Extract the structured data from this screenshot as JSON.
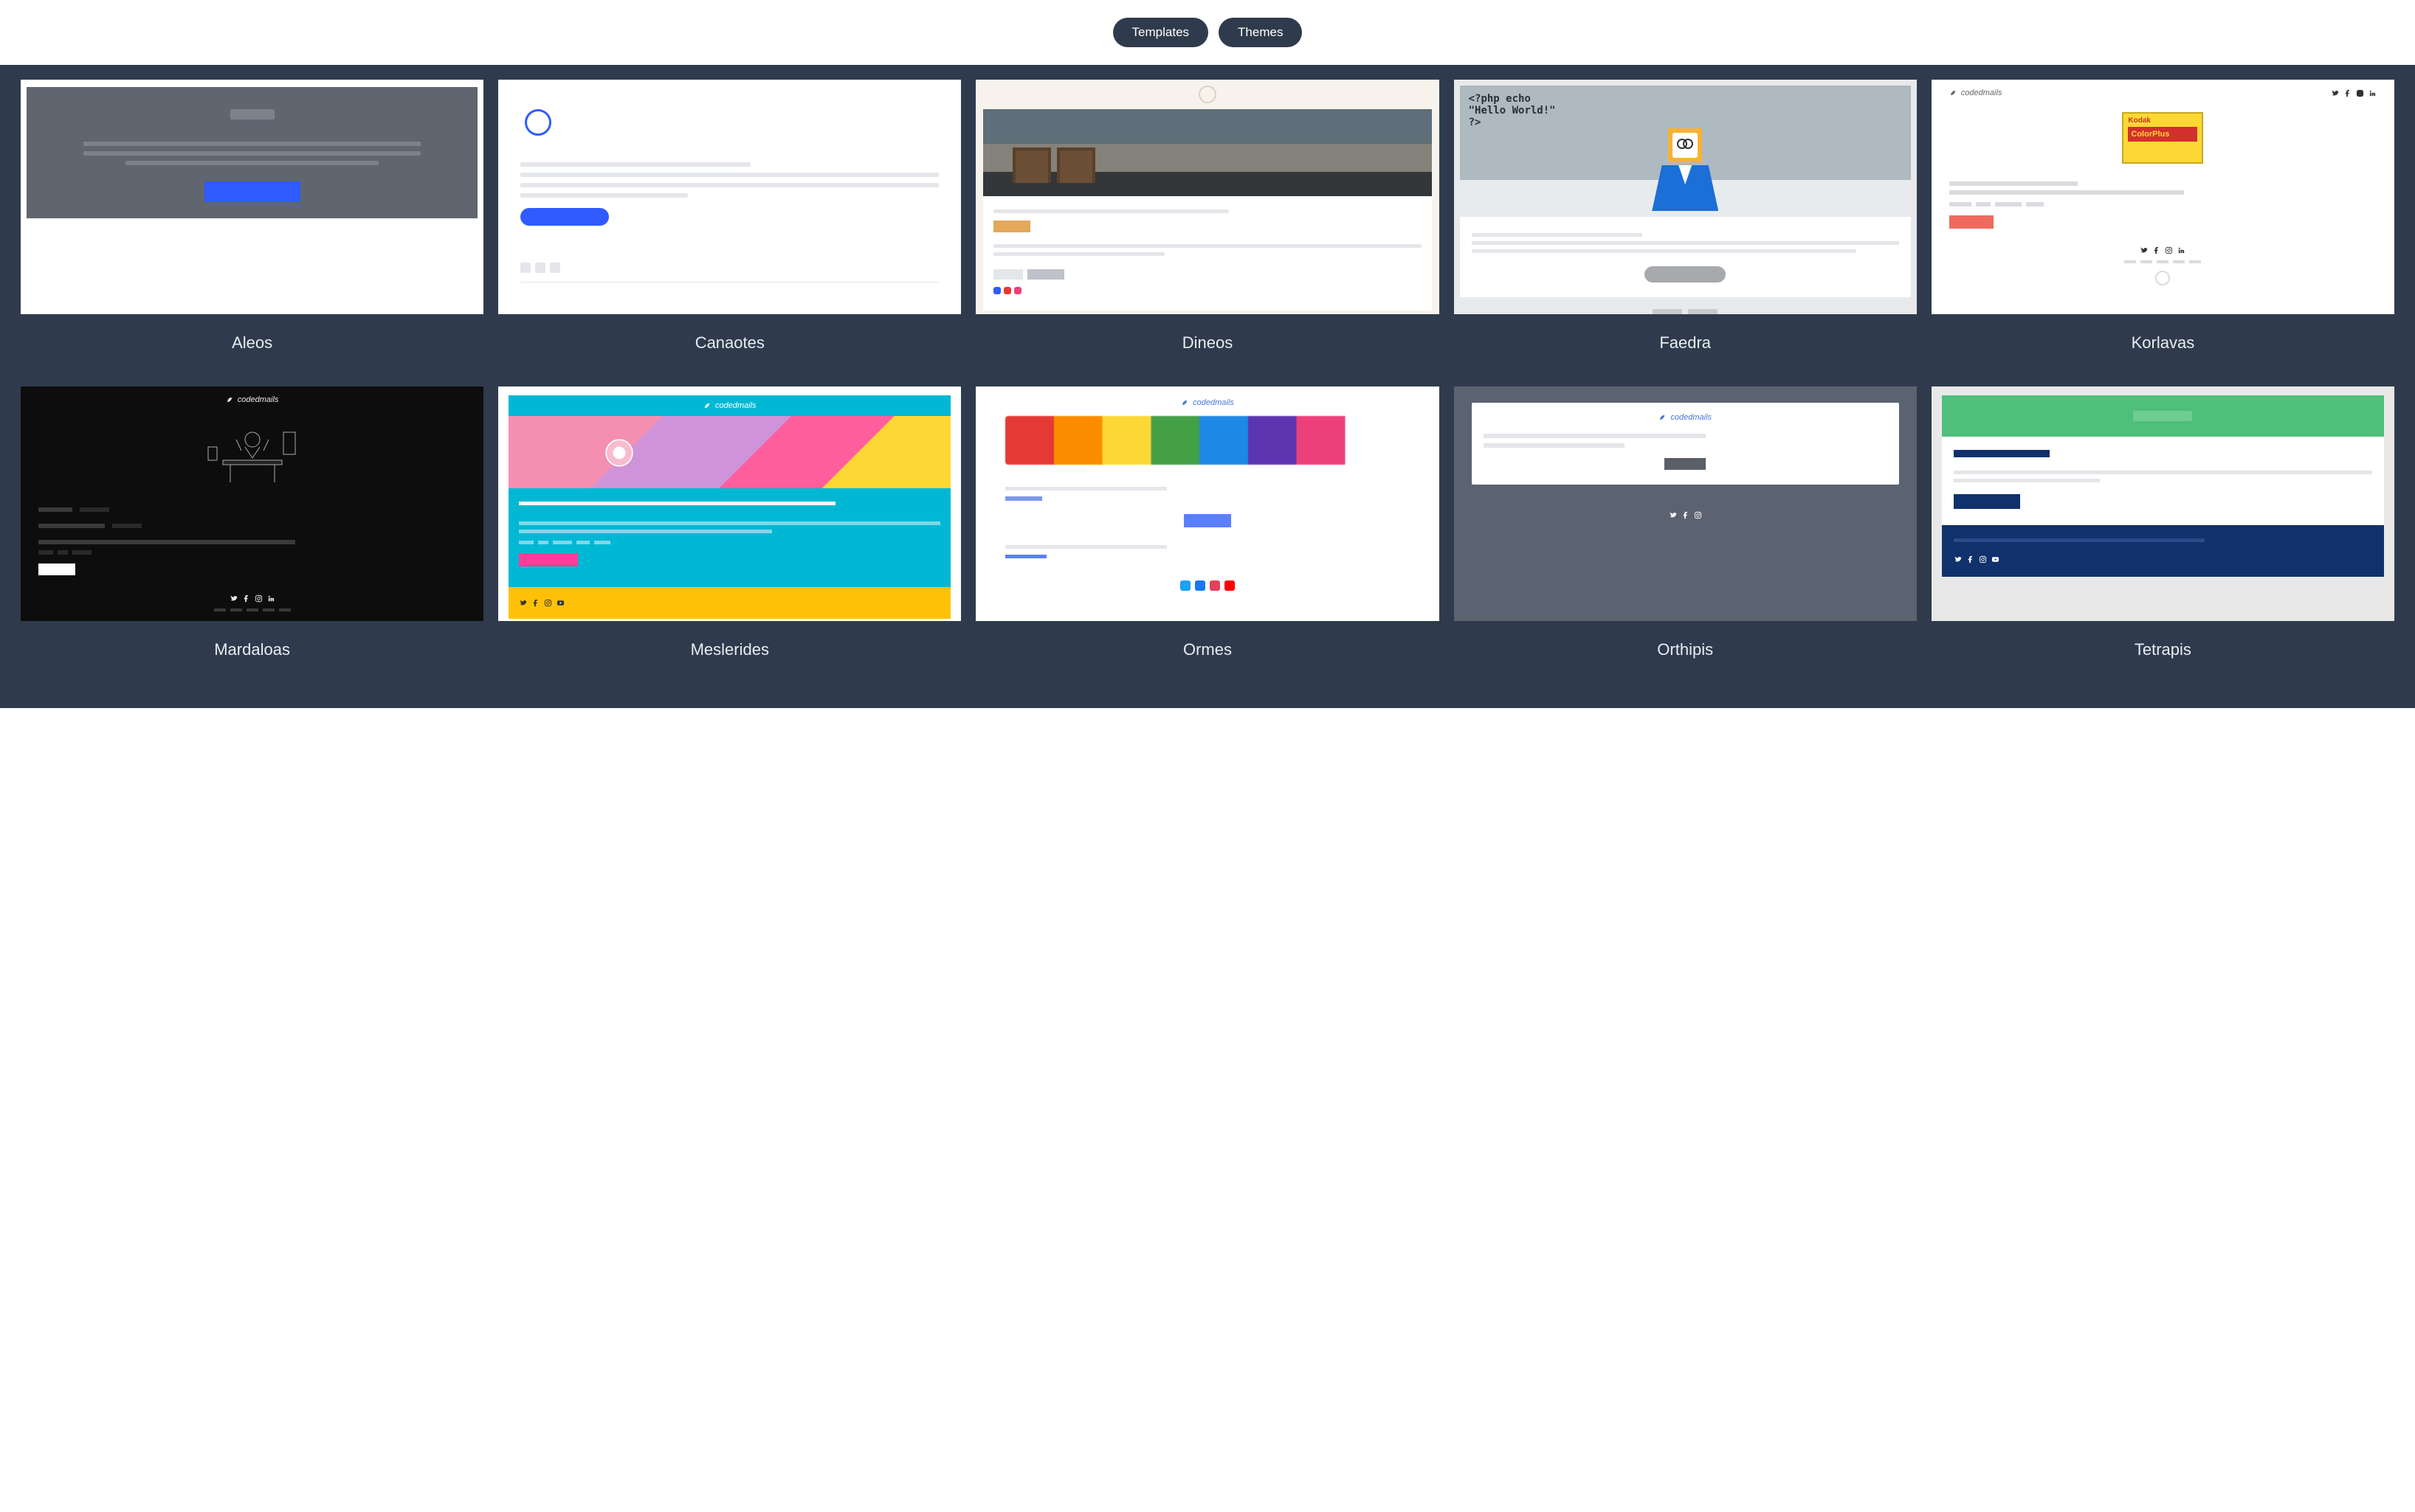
{
  "tabs": {
    "templates": "Templates",
    "themes": "Themes"
  },
  "themes": [
    {
      "name": "Aleos"
    },
    {
      "name": "Canaotes"
    },
    {
      "name": "Dineos"
    },
    {
      "name": "Faedra"
    },
    {
      "name": "Korlavas"
    },
    {
      "name": "Mardaloas"
    },
    {
      "name": "Meslerides"
    },
    {
      "name": "Ormes"
    },
    {
      "name": "Orthipis"
    },
    {
      "name": "Tetrapis"
    }
  ],
  "preview_text": {
    "faedra_code": "<?php echo\n\"Hello World!\"\n?>",
    "brand": "codedmails",
    "kodak": "Kodak",
    "colorplus": "ColorPlus"
  },
  "colors": {
    "page_bg": "#2F3B4C",
    "accent_blue": "#2F5BFF",
    "accent_orange": "#E3A859",
    "accent_pink": "#FF3D9A",
    "accent_cyan": "#00B8D4",
    "accent_green": "#4FBF7C",
    "accent_navy": "#10316B",
    "accent_coral": "#EF6A5E",
    "accent_yellow": "#FFC107"
  }
}
